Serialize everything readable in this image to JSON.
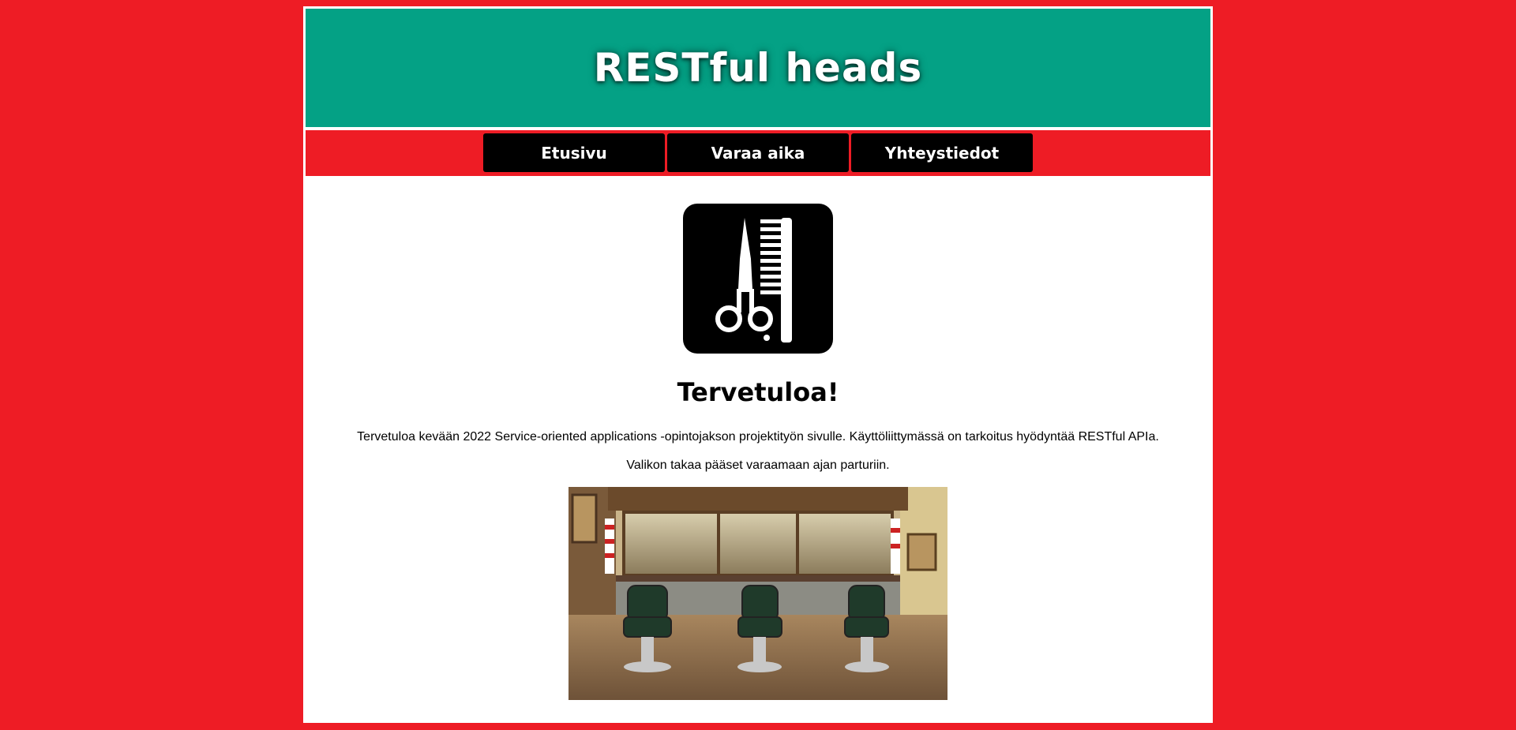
{
  "header": {
    "title": "RESTful heads"
  },
  "nav": {
    "items": [
      {
        "label": "Etusivu"
      },
      {
        "label": "Varaa aika"
      },
      {
        "label": "Yhteystiedot"
      }
    ]
  },
  "main": {
    "logo_icon": "scissors-comb-icon",
    "heading": "Tervetuloa!",
    "paragraph_1": "Tervetuloa kevään 2022 Service-oriented applications -opintojakson projektityön sivulle. Käyttöliittymässä on tarkoitus hyödyntää RESTful APIa.",
    "paragraph_2": "Valikon takaa pääset varaamaan ajan parturiin.",
    "photo": "barbershop-interior-photo"
  },
  "colors": {
    "background": "#ee1c25",
    "header": "#04a185",
    "nav_button": "#000000",
    "content": "#ffffff"
  }
}
